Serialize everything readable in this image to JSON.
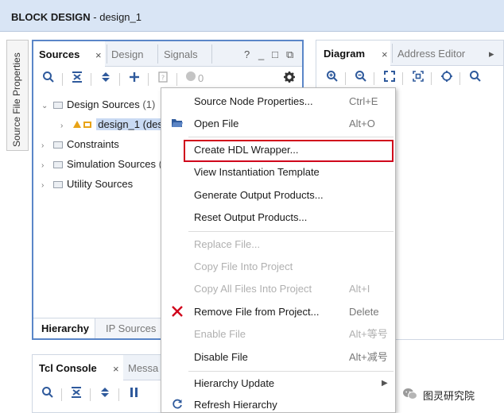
{
  "window": {
    "title_bold": "BLOCK DESIGN",
    "title_rest": " - design_1"
  },
  "side_tab": {
    "label": "Source File Properties"
  },
  "sources_panel": {
    "tabs": [
      {
        "label": "Sources",
        "close": "×"
      },
      {
        "label": "Design"
      },
      {
        "label": "Signals"
      }
    ],
    "window_controls": [
      "?",
      "_",
      "□",
      "⧉"
    ],
    "toolbar_count": "0",
    "tree": [
      {
        "label": "Design Sources",
        "count": "(1)",
        "expanded": true
      },
      {
        "label": "design_1 (des",
        "selected": true
      },
      {
        "label": "Constraints"
      },
      {
        "label": "Simulation Sources",
        "suffix": "("
      },
      {
        "label": "Utility Sources"
      }
    ],
    "bottom_tabs": [
      "Hierarchy",
      "IP Sources"
    ]
  },
  "diagram_panel": {
    "tabs": [
      {
        "label": "Diagram",
        "close": "×"
      },
      {
        "label": "Address Editor"
      }
    ],
    "more": "▸"
  },
  "tcl_panel": {
    "tabs": [
      {
        "label": "Tcl Console",
        "close": "×"
      },
      {
        "label": "Messa"
      }
    ]
  },
  "context_menu": {
    "items": [
      {
        "label": "Source Node Properties...",
        "shortcut": "Ctrl+E"
      },
      {
        "label": "Open File",
        "shortcut": "Alt+O",
        "icon": "folder-open-icon"
      },
      {
        "label": "Create HDL Wrapper...",
        "highlighted": true
      },
      {
        "label": "View Instantiation Template"
      },
      {
        "label": "Generate Output Products..."
      },
      {
        "label": "Reset Output Products..."
      },
      {
        "label": "Replace File...",
        "disabled": true
      },
      {
        "label": "Copy File Into Project",
        "disabled": true
      },
      {
        "label": "Copy All Files Into Project",
        "shortcut": "Alt+I",
        "disabled": true
      },
      {
        "label": "Remove File from Project...",
        "shortcut": "Delete",
        "icon": "remove-x-icon"
      },
      {
        "label": "Enable File",
        "shortcut": "Alt+等号",
        "disabled": true
      },
      {
        "label": "Disable File",
        "shortcut": "Alt+减号"
      },
      {
        "label": "Hierarchy Update",
        "submenu": true
      },
      {
        "label": "Refresh Hierarchy",
        "icon": "refresh-icon"
      }
    ]
  },
  "watermark": {
    "text": "图灵研究院"
  },
  "colors": {
    "accent": "#5a86c8",
    "highlight_border": "#d0021b",
    "remove_icon": "#d0021b",
    "title_bar": "#d9e5f5"
  }
}
